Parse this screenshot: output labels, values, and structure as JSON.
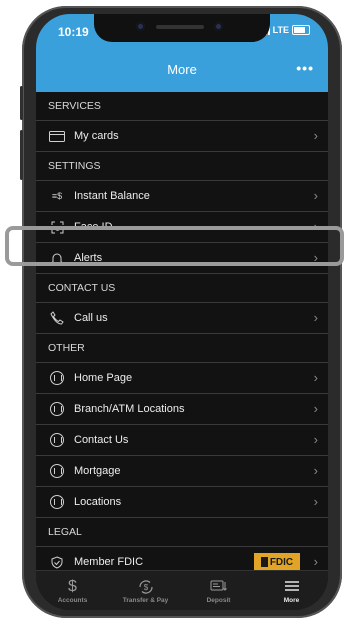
{
  "status_bar": {
    "time": "10:19",
    "network": "LTE"
  },
  "header": {
    "title": "More",
    "menu_icon": "more-dots-icon"
  },
  "sections": {
    "services": "SERVICES",
    "settings": "SETTINGS",
    "contact": "CONTACT US",
    "other": "OTHER",
    "legal": "LEGAL"
  },
  "items": {
    "my_cards": "My cards",
    "instant_balance": "Instant Balance",
    "face_id": "Face ID",
    "alerts": "Alerts",
    "call_us": "Call us",
    "home_page": "Home Page",
    "branch_atm": "Branch/ATM Locations",
    "contact_us": "Contact Us",
    "mortgage": "Mortgage",
    "locations": "Locations",
    "member_fdic": "Member FDIC"
  },
  "fdic_badge": "FDIC",
  "tabs": {
    "accounts": "Accounts",
    "transfer": "Transfer & Pay",
    "deposit": "Deposit",
    "more": "More"
  },
  "colors": {
    "accent": "#3aa0dc",
    "fdic": "#e2a426",
    "background": "#121212"
  }
}
